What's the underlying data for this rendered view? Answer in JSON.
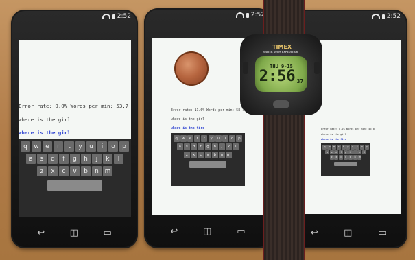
{
  "phones": [
    {
      "id": "left",
      "status_time": "2:52",
      "error_line": "Error rate: 0.0%  Words per min: 53.7",
      "phrase": "where is the girl",
      "typed": "where is the girl",
      "keyboard": {
        "rows": [
          [
            "q",
            "w",
            "e",
            "r",
            "t",
            "y",
            "u",
            "i",
            "o",
            "p"
          ],
          [
            "a",
            "s",
            "d",
            "f",
            "g",
            "h",
            "j",
            "k",
            "l"
          ],
          [
            "z",
            "x",
            "c",
            "v",
            "b",
            "n",
            "m"
          ]
        ]
      }
    },
    {
      "id": "middle",
      "status_time": "2:52",
      "error_line": "Error rate: 11.0%  Words per min: 58.7",
      "phrase": "where is the girl",
      "typed": "where is the fire",
      "keyboard": {
        "rows": [
          [
            "q",
            "w",
            "e",
            "r",
            "t",
            "y",
            "u",
            "i",
            "o",
            "p"
          ],
          [
            "a",
            "s",
            "d",
            "f",
            "g",
            "h",
            "j",
            "k",
            "l"
          ],
          [
            "z",
            "x",
            "c",
            "v",
            "b",
            "n",
            "m"
          ]
        ]
      }
    },
    {
      "id": "right",
      "status_time": "2:52",
      "error_line": "Error rate: 0.0%  Words per min: 46.0",
      "phrase": "where is the girl",
      "typed": "where is the fire",
      "keyboard": {
        "rows": [
          [
            "q",
            "w",
            "e",
            "r",
            "t",
            "y",
            "u",
            "i",
            "o",
            "p"
          ],
          [
            "a",
            "s",
            "d",
            "f",
            "g",
            "h",
            "j",
            "k",
            "l"
          ],
          [
            "z",
            "x",
            "c",
            "v",
            "b",
            "n",
            "m"
          ]
        ]
      }
    }
  ],
  "nav_icons": [
    "back-icon",
    "home-icon",
    "recent-apps-icon"
  ],
  "watch": {
    "brand": "TIMEX",
    "tagline": "WATER 100M EXPEDITION",
    "time": "2:56",
    "seconds": "37",
    "date": "THU 9-15"
  },
  "colors": {
    "typed_text": "#2a3fd0",
    "screen": "#f4f7f4",
    "key": "#6a6a6a",
    "lcd": "#9fc65e"
  }
}
